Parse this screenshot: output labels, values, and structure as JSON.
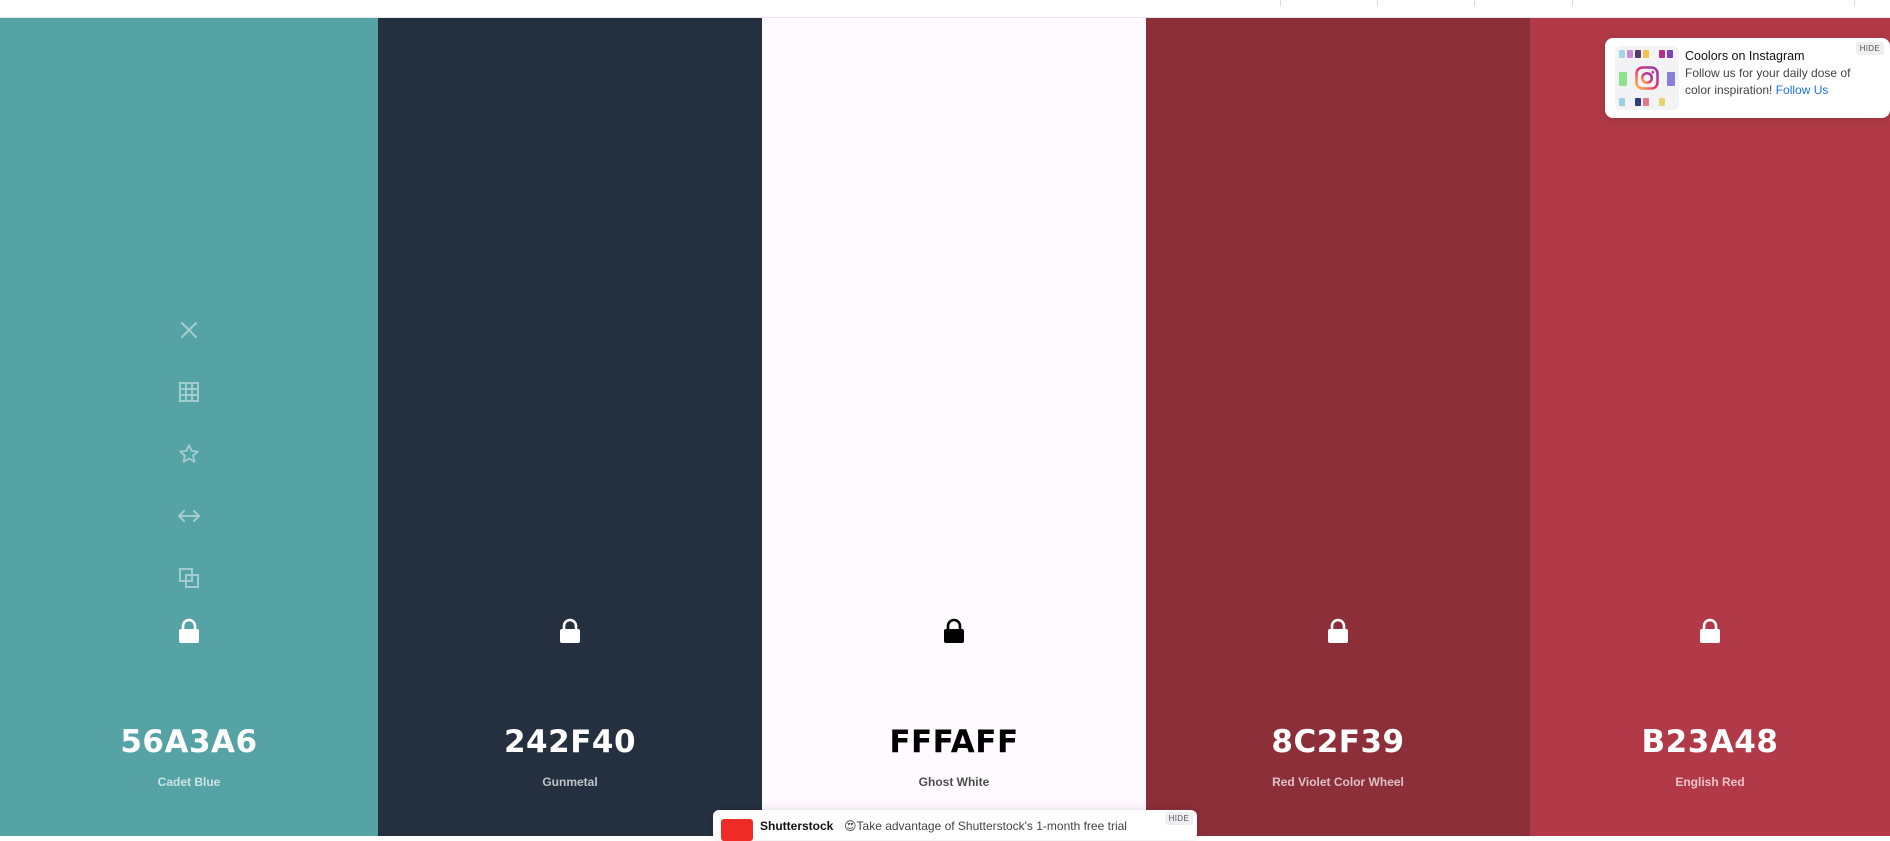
{
  "swatches": [
    {
      "hex": "56A3A6",
      "name": "Cadet Blue",
      "bg": "#56A3A6",
      "fg": "#ffffff",
      "lock_icon": "lock-icon",
      "tools": [
        "close-icon",
        "grid-icon",
        "star-icon",
        "arrows-horizontal-icon",
        "copy-icon"
      ]
    },
    {
      "hex": "242F40",
      "name": "Gunmetal",
      "bg": "#242F40",
      "fg": "#ffffff",
      "lock_icon": "lock-icon"
    },
    {
      "hex": "FFFAFF",
      "name": "Ghost White",
      "bg": "#FFFAFF",
      "fg": "#000000",
      "lock_icon": "lock-icon"
    },
    {
      "hex": "8C2F39",
      "name": "Red Violet Color Wheel",
      "bg": "#8C2F39",
      "fg": "#ffffff",
      "lock_icon": "lock-icon"
    },
    {
      "hex": "B23A48",
      "name": "English Red",
      "bg": "#B23A48",
      "fg": "#ffffff",
      "lock_icon": "lock-icon"
    }
  ],
  "instagram_popup": {
    "title": "Coolors on Instagram",
    "body": "Follow us for your daily dose of color inspiration!",
    "link": "Follow Us",
    "hide": "HIDE",
    "icon": "instagram-icon"
  },
  "shutterstock_banner": {
    "brand": "Shutterstock",
    "emoji": "😍",
    "message": "Take advantage of Shutterstock's 1-month free trial",
    "hide": "HIDE"
  }
}
